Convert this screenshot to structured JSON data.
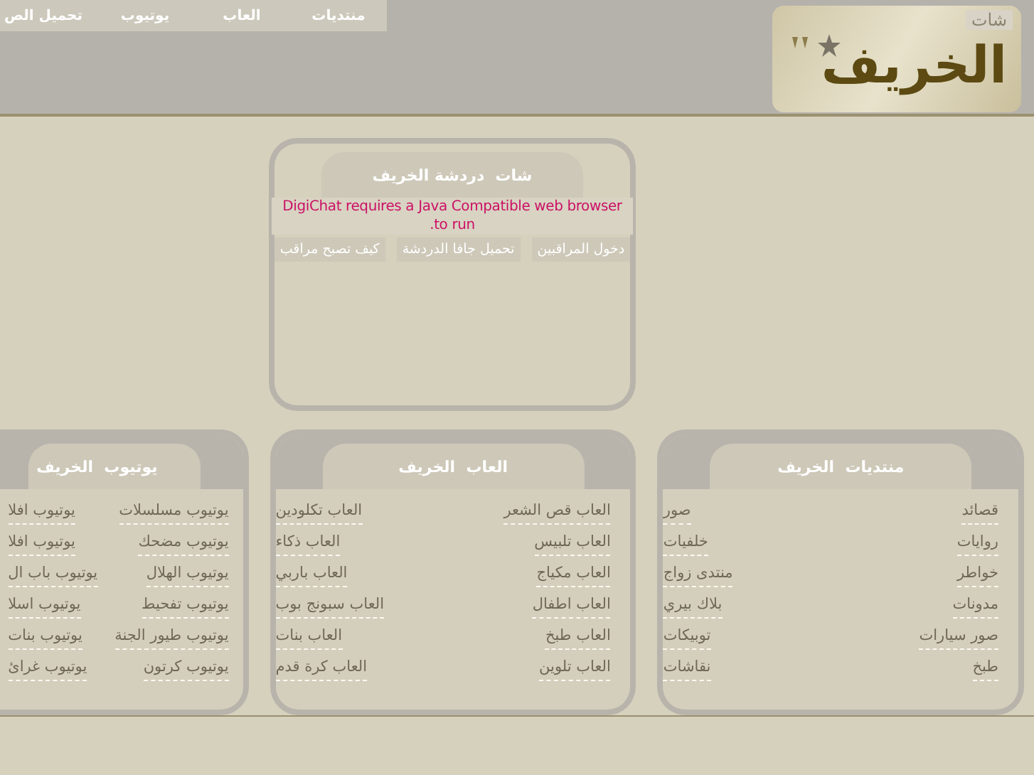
{
  "header": {
    "logo": {
      "tag": "شات",
      "name": "الخريف"
    },
    "nav": [
      "منتديات",
      "العاب",
      "يوتيوب",
      "تحميل الص"
    ]
  },
  "chat": {
    "title": "شات  دردشة الخريف",
    "message": "DigiChat requires a Java Compatible web browser to run.",
    "buttons": [
      "دخول المراقبين",
      "تحميل جافا الدردشة",
      "كيف تصبح مراقب"
    ]
  },
  "sections": [
    {
      "title": "منتديات  الخريف",
      "columns": [
        [
          "قصائد",
          "روايات",
          "خواطر",
          "مدونات",
          "صور سيارات",
          "طبخ"
        ],
        [
          "صور",
          "خلفيات",
          "منتدى زواج",
          "بلاك بيري",
          "توبيكات",
          "نقاشات"
        ]
      ]
    },
    {
      "title": "العاب  الخريف",
      "columns": [
        [
          "العاب قص الشعر",
          "العاب تلبيس",
          "العاب مكياج",
          "العاب اطفال",
          "العاب طبخ",
          "العاب تلوين"
        ],
        [
          "العاب تكلودين",
          "العاب ذكاء",
          "العاب باربي",
          "العاب سبونج بوب",
          "العاب بنات",
          "العاب كرة قدم"
        ]
      ]
    },
    {
      "title": "يوتيوب  الخريف",
      "columns": [
        [
          "يوتيوب مسلسلات",
          "يوتيوب مضحك",
          "يوتيوب الهلال",
          "يوتيوب تفحيط",
          "يوتيوب طيور الجنة",
          "يوتيوب كرتون"
        ],
        [
          "يوتيوب افلا",
          "يوتيوب افلا",
          "يوتيوب باب ال",
          "يوتيوب اسلا",
          "يوتيوب بنات",
          "يوتيوب غرائ"
        ]
      ]
    }
  ]
}
